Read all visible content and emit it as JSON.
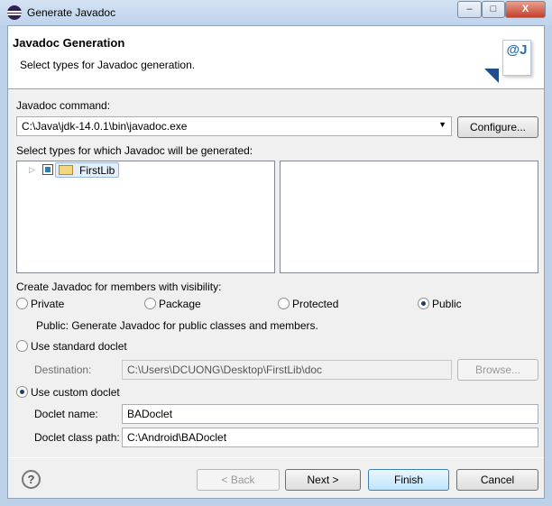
{
  "window": {
    "title": "Generate Javadoc",
    "minimize": "–",
    "maximize": "□",
    "close": "X"
  },
  "header": {
    "title": "Javadoc Generation",
    "subtitle": "Select types for Javadoc generation.",
    "icon_text": "@J"
  },
  "command": {
    "label": "Javadoc command:",
    "value": "C:\\Java\\jdk-14.0.1\\bin\\javadoc.exe",
    "configure": "Configure..."
  },
  "types": {
    "label": "Select types for which Javadoc will be generated:",
    "tree": [
      {
        "label": "FirstLib"
      }
    ]
  },
  "visibility": {
    "label": "Create Javadoc for members with visibility:",
    "options": [
      "Private",
      "Package",
      "Protected",
      "Public"
    ],
    "selected": "Public",
    "description": "Public: Generate Javadoc for public classes and members."
  },
  "standard": {
    "label": "Use standard doclet",
    "destination_label": "Destination:",
    "destination": "C:\\Users\\DCUONG\\Desktop\\FirstLib\\doc",
    "browse": "Browse..."
  },
  "custom": {
    "label": "Use custom doclet",
    "name_label": "Doclet name:",
    "name": "BADoclet",
    "path_label": "Doclet class path:",
    "path": "C:\\Android\\BADoclet"
  },
  "buttons": {
    "help": "?",
    "back": "< Back",
    "next": "Next >",
    "finish": "Finish",
    "cancel": "Cancel"
  }
}
